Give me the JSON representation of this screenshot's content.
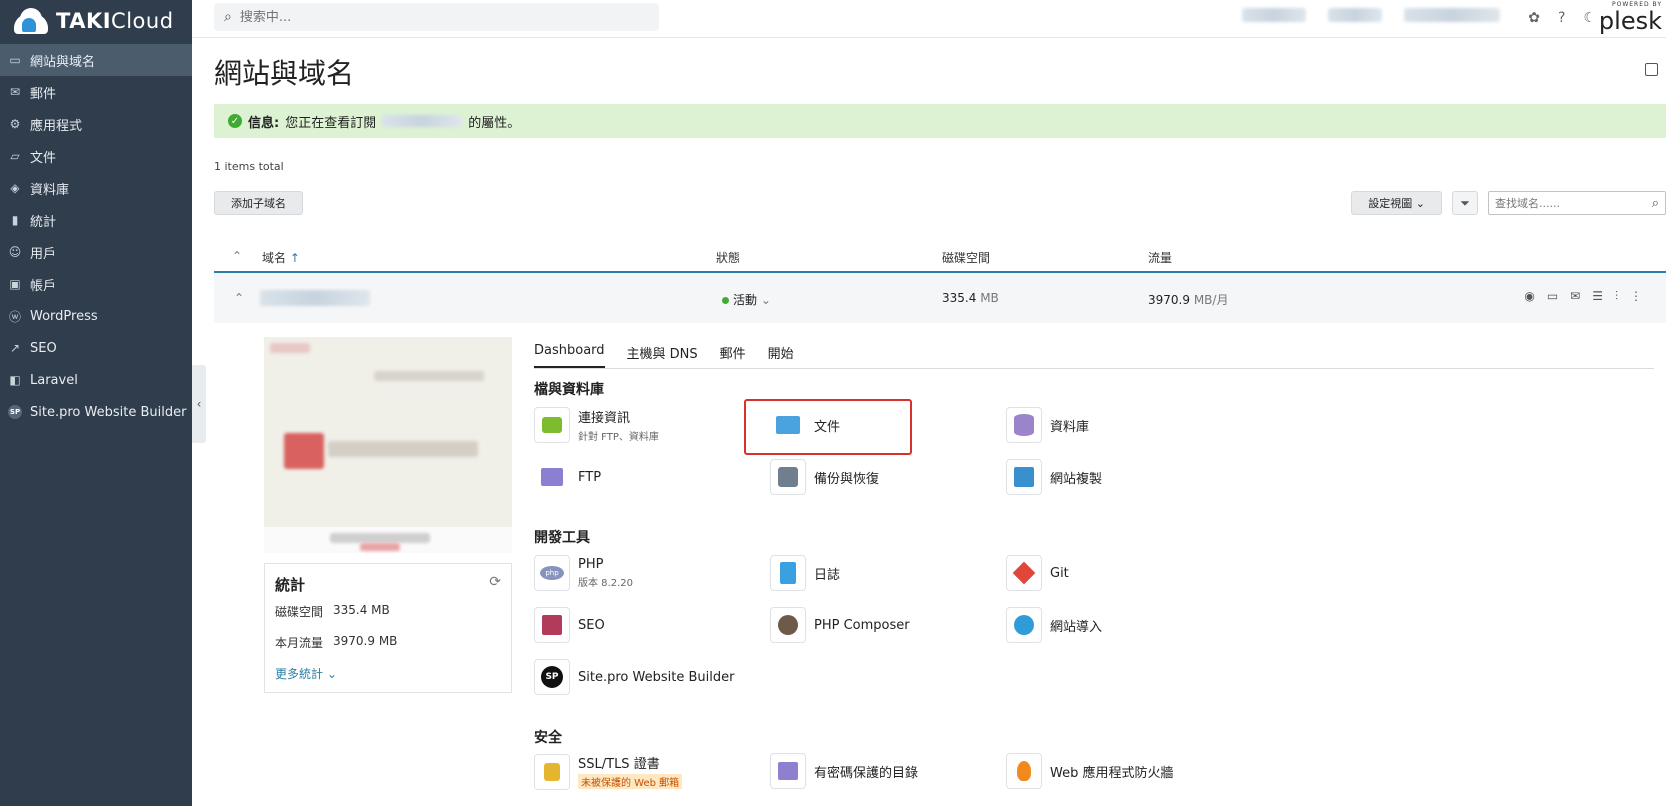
{
  "brand": {
    "logo_bold": "TAKI",
    "logo_light": "Cloud"
  },
  "sidebar": {
    "items": [
      {
        "label": "網站與域名",
        "icon": "monitor-icon"
      },
      {
        "label": "郵件",
        "icon": "mail-icon"
      },
      {
        "label": "應用程式",
        "icon": "gear-icon"
      },
      {
        "label": "文件",
        "icon": "folder-icon"
      },
      {
        "label": "資料庫",
        "icon": "layers-icon"
      },
      {
        "label": "統計",
        "icon": "bar-chart-icon"
      },
      {
        "label": "用戶",
        "icon": "user-icon"
      },
      {
        "label": "帳戶",
        "icon": "briefcase-icon"
      },
      {
        "label": "WordPress",
        "icon": "wordpress-icon"
      },
      {
        "label": "SEO",
        "icon": "seo-icon"
      },
      {
        "label": "Laravel",
        "icon": "laravel-icon"
      },
      {
        "label": "Site.pro Website Builder",
        "icon": "sitepro-icon"
      }
    ],
    "collapse": "‹"
  },
  "topbar": {
    "search_placeholder": "搜索中...",
    "powered": "POWERED BY",
    "plesk": "plesk"
  },
  "main": {
    "title": "網站與域名",
    "info_label": "信息:",
    "info_text": " 您正在查看訂閱 ",
    "info_suffix": "的屬性。",
    "count": "1 items total",
    "add_subdomain": "添加子域名",
    "set_view": "設定視圖 ⌄",
    "find_placeholder": "查找域名......"
  },
  "table": {
    "columns": {
      "domain": "域名",
      "status": "狀態",
      "disk": "磁碟空間",
      "traffic": "流量"
    },
    "row": {
      "status": "活動",
      "disk_value": "335.4",
      "disk_unit": "MB",
      "traffic_value": "3970.9",
      "traffic_unit": "MB/月"
    }
  },
  "stats": {
    "title": "統計",
    "disk_label": "磁碟空間",
    "disk_value": "335.4 MB",
    "traffic_label": "本月流量",
    "traffic_value": "3970.9 MB",
    "more": "更多統計"
  },
  "tabs": [
    "Dashboard",
    "主機與 DNS",
    "郵件",
    "開始"
  ],
  "sections": {
    "files": "檔與資料庫",
    "dev": "開發工具",
    "security": "安全"
  },
  "tiles": {
    "connect": {
      "label": "連接資訊",
      "sub": "針對 FTP、資料庫"
    },
    "files": {
      "label": "文件"
    },
    "database": {
      "label": "資料庫"
    },
    "ftp": {
      "label": "FTP"
    },
    "backup": {
      "label": "備份與恢復"
    },
    "copy": {
      "label": "網站複製"
    },
    "php": {
      "label": "PHP",
      "sub": "版本 8.2.20"
    },
    "logs": {
      "label": "日誌"
    },
    "git": {
      "label": "Git"
    },
    "seo": {
      "label": "SEO"
    },
    "composer": {
      "label": "PHP Composer"
    },
    "import": {
      "label": "網站導入"
    },
    "sitepro": {
      "label": "Site.pro Website Builder"
    },
    "ssl": {
      "label": "SSL/TLS 證書",
      "warn": "未被保護的 Web 郵箱"
    },
    "protected": {
      "label": "有密碼保護的目錄"
    },
    "waf": {
      "label": "Web 應用程式防火牆"
    }
  }
}
